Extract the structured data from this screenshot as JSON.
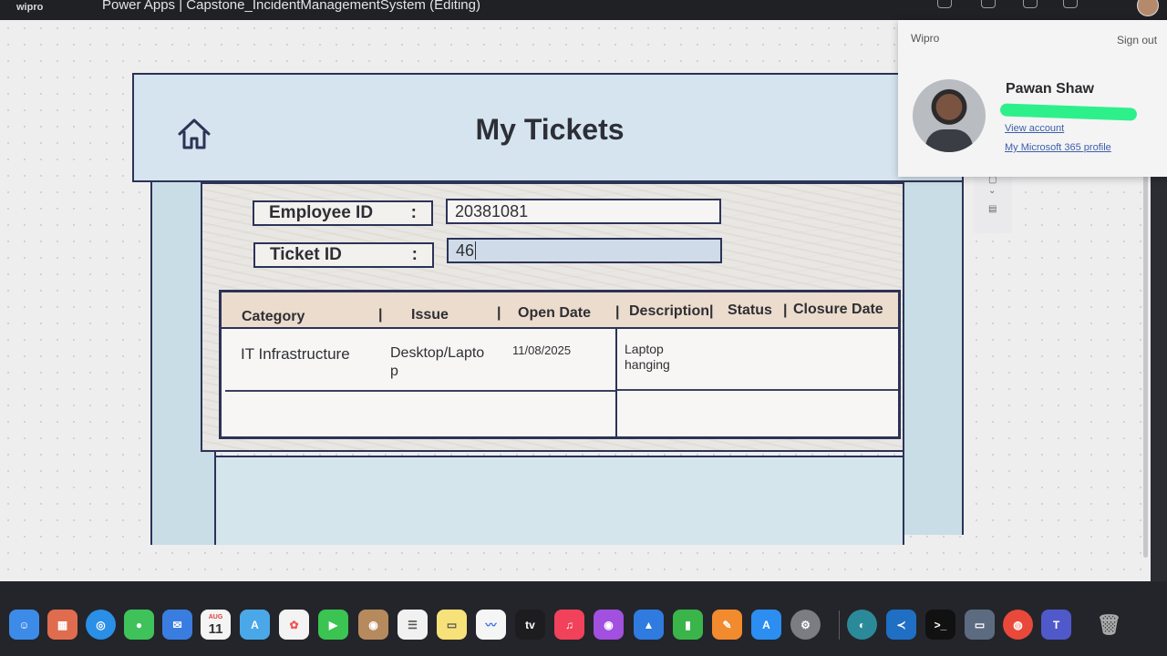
{
  "topbar": {
    "brand": "wipro",
    "app_title": "Power Apps  |  Capstone_IncidentManagementSystem (Editing)"
  },
  "header": {
    "title": "My Tickets",
    "home_icon": "home-icon"
  },
  "form": {
    "employee_id_label": "Employee ID",
    "employee_id_value": "20381081",
    "ticket_id_label": "Ticket ID",
    "ticket_id_value": "46",
    "colon": ":"
  },
  "table": {
    "headers": [
      "Category",
      "|",
      "Issue",
      "|",
      "Open Date",
      "|",
      "Description|",
      "Status",
      "|",
      "Closure Date"
    ],
    "rows": [
      {
        "category": "IT Infrastructure",
        "issue_line1": "Desktop/Lapto",
        "issue_line2": "p",
        "open_date": "11/08/2025",
        "description_line1": "Laptop",
        "description_line2": "hanging"
      }
    ]
  },
  "profile": {
    "org": "Wipro",
    "sign_out": "Sign out",
    "name": "Pawan Shaw",
    "view_account": "View account",
    "m365_profile": "My Microsoft 365 profile"
  },
  "dock": {
    "calendar_month": "AUG",
    "calendar_day": "11",
    "tv_label": "tv"
  },
  "colors": {
    "border": "#2c3357",
    "header_bg": "#d5e4ee",
    "table_header_bg": "#ecdccd",
    "ticket_input_bg": "#cfdbe8",
    "link": "#3d5fa8"
  }
}
